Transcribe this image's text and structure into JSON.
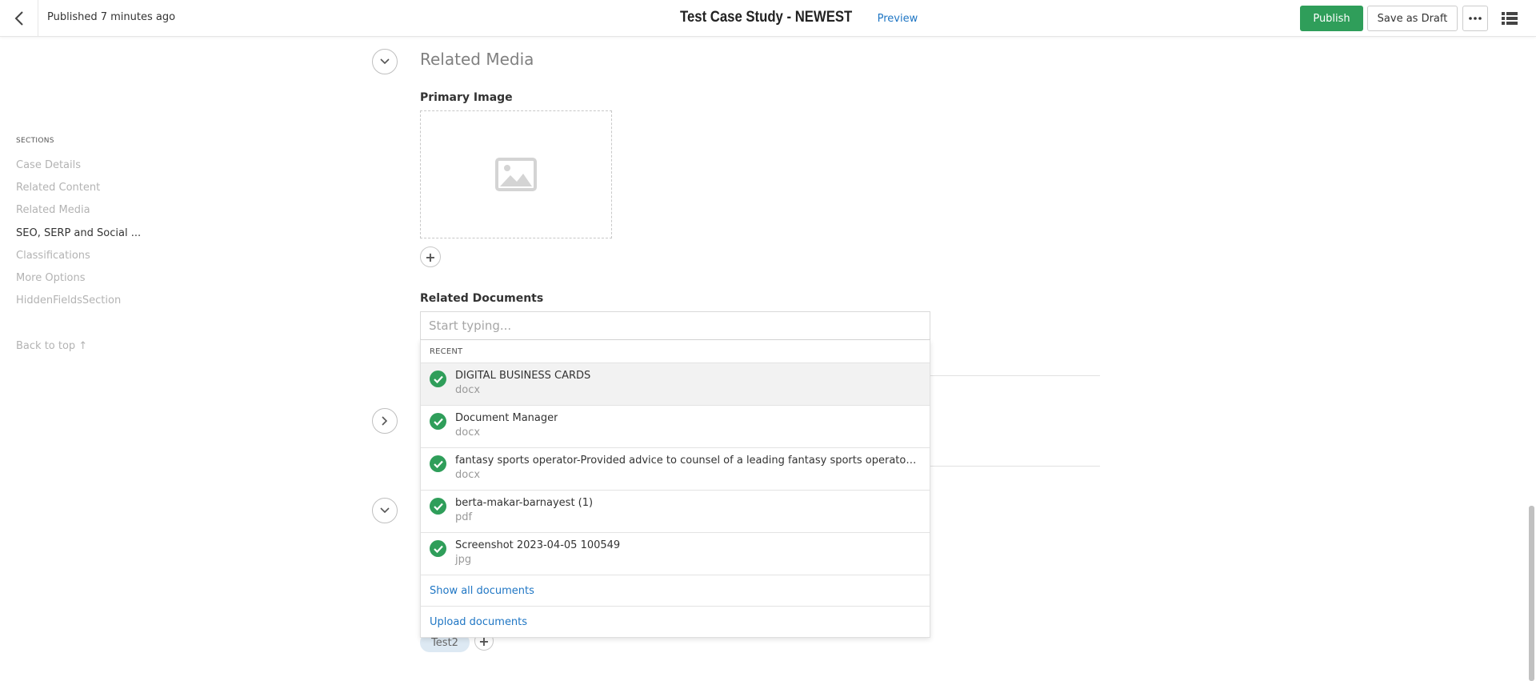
{
  "header": {
    "published_status": "Published 7 minutes ago",
    "title": "Test Case Study - NEWEST",
    "preview_label": "Preview",
    "publish_label": "Publish",
    "save_draft_label": "Save as Draft"
  },
  "sidebar": {
    "heading": "SECTIONS",
    "items": [
      {
        "label": "Case Details",
        "active": false
      },
      {
        "label": "Related Content",
        "active": false
      },
      {
        "label": "Related Media",
        "active": false
      },
      {
        "label": "SEO, SERP and Social ...",
        "active": true
      },
      {
        "label": "Classifications",
        "active": false
      },
      {
        "label": "More Options",
        "active": false
      },
      {
        "label": "HiddenFieldsSection",
        "active": false
      }
    ],
    "back_to_top": "Back to top ↑"
  },
  "main": {
    "section_title": "Related Media",
    "primary_image_label": "Primary Image",
    "related_documents_label": "Related Documents",
    "search": {
      "placeholder": "Start typing...",
      "value": ""
    },
    "dropdown": {
      "recent_label": "RECENT",
      "documents": [
        {
          "name": "DIGITAL BUSINESS CARDS",
          "ext": "docx"
        },
        {
          "name": "Document Manager",
          "ext": "docx"
        },
        {
          "name": "fantasy sports operator-Provided advice to counsel of a leading fantasy sports operator on Ca...",
          "ext": "docx"
        },
        {
          "name": "berta-makar-barnayest (1)",
          "ext": "pdf"
        },
        {
          "name": "Screenshot 2023-04-05 100549",
          "ext": "jpg"
        }
      ],
      "show_all": "Show all documents",
      "upload": "Upload documents"
    },
    "tag_label": "Test2"
  },
  "colors": {
    "publish": "#2f9e5a",
    "link": "#1f76c4",
    "arrow": "#0d3b5e",
    "tag_bg": "#dde9f3"
  }
}
